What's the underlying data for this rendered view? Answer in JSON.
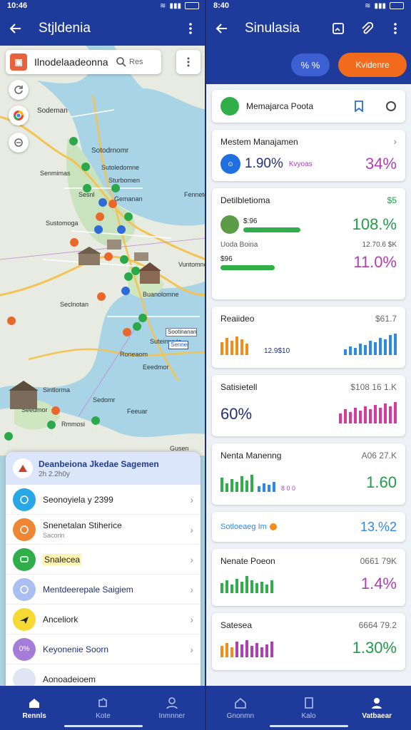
{
  "status_left": {
    "time": "10:46"
  },
  "status_right": {
    "time": "8:40"
  },
  "left": {
    "title": "Stjldenia",
    "search_value": "Ilnodelaadeonna",
    "search_sub": "Res",
    "map_labels": [
      "Sodeman",
      "Sotodrnomr",
      "Sutoledomne",
      "Senmimas",
      "Sturbomen",
      "Fennetomn",
      "Sustomoga",
      "Vuntomnom",
      "Buanolomne",
      "Seclnotan",
      "Suteimuvia",
      "Roneaom",
      "Eeedmor",
      "Sintlorma",
      "Sedomr",
      "Seedmor",
      "Feeuar",
      "Rmmosi",
      "Gusen",
      "Sootinanan",
      "Senner",
      "Sesnl",
      "Gemanan"
    ],
    "sheet": {
      "title": "Deanbeiona Jkedae Sagemen",
      "subtitle": "2h 2.2h0y",
      "items": [
        {
          "label": "Seonoyiela y 2399",
          "sub": ""
        },
        {
          "label": "Snenetalan Stiherice",
          "sub": "Sacorin"
        },
        {
          "label": "Snalecea",
          "sub": ""
        },
        {
          "label": "Mentdeerepale Saigiem",
          "sub": ""
        },
        {
          "label": "Anceliork",
          "sub": ""
        },
        {
          "label": "Keyonenie Soorn",
          "sub": ""
        },
        {
          "label": "Aonoadeioem",
          "sub": ""
        }
      ]
    },
    "nav": [
      "Rennls",
      "Kote",
      "Inmnner"
    ]
  },
  "right": {
    "title": "Sinulasia",
    "toggle_label": "% %",
    "cta_label": "Kvidenre",
    "top_card": {
      "label": "Memajarca Poota"
    },
    "system": {
      "title": "Mestem Manajamen",
      "value": "1.90%",
      "unit": "Kvyoas",
      "percent": "34%"
    },
    "detail": {
      "title": "Detilbletioma",
      "badge": "$5",
      "row1_amount": "$:96",
      "row1_percent": "108.%",
      "row2_label": "Uoda Boina",
      "row2_value": "12.70.6 $K",
      "row2_amount": "$96",
      "row2_percent": "11.0%"
    },
    "residue": {
      "title": "Reaiideo",
      "value": "$61.7",
      "mid": "12.9$10"
    },
    "satis": {
      "title": "Satisietell",
      "value": "$108 16 1.K",
      "percent": "60%"
    },
    "nenta": {
      "title": "Nenta Manenng",
      "value": "A06 27.K",
      "sub": "8 0 0",
      "percent": "1.60"
    },
    "soloeng": {
      "title": "Sotloeaeg Im",
      "percent": "13.%2"
    },
    "nenate": {
      "title": "Nenate Poeon",
      "value": "0661 79K",
      "percent": "1.4%"
    },
    "satesea": {
      "title": "Satesea",
      "value": "6664 79.2",
      "percent": "1.30%"
    },
    "nav": [
      "Gnonmn",
      "Kalo",
      "Vatbaear"
    ],
    "colors": {
      "green": "#1f9d48",
      "purple": "#b03fb2",
      "orange": "#f28c1b",
      "blue": "#2e88e6",
      "magenta": "#d63a9e",
      "navy": "#22307a"
    }
  }
}
